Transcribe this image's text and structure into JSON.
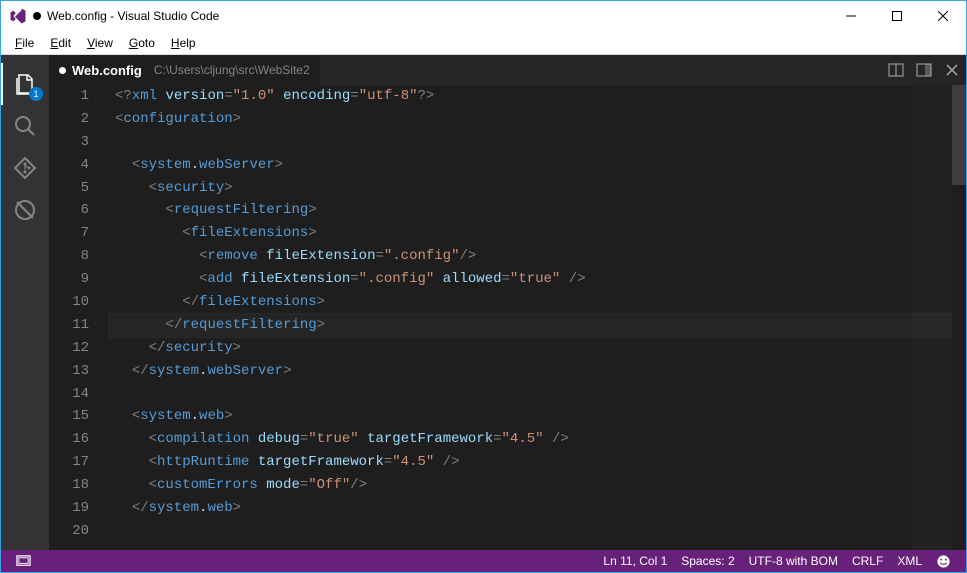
{
  "window": {
    "title": "Web.config - Visual Studio Code",
    "dirty": true
  },
  "menubar": {
    "items": [
      {
        "label": "File",
        "u": 0
      },
      {
        "label": "Edit",
        "u": 0
      },
      {
        "label": "View",
        "u": 0
      },
      {
        "label": "Goto",
        "u": 0
      },
      {
        "label": "Help",
        "u": 0
      }
    ]
  },
  "activitybar": {
    "explorer_badge": "1"
  },
  "tabs": {
    "file": "Web.config",
    "path": "C:\\Users\\cljung\\src\\WebSite2"
  },
  "editor": {
    "lines": [
      [
        {
          "t": "br",
          "v": "<?"
        },
        {
          "t": "tag",
          "v": "xml"
        },
        {
          "t": "plain",
          "v": " "
        },
        {
          "t": "attr",
          "v": "version"
        },
        {
          "t": "br",
          "v": "="
        },
        {
          "t": "str",
          "v": "\"1.0\""
        },
        {
          "t": "plain",
          "v": " "
        },
        {
          "t": "attr",
          "v": "encoding"
        },
        {
          "t": "br",
          "v": "="
        },
        {
          "t": "str",
          "v": "\"utf-8\""
        },
        {
          "t": "br",
          "v": "?>"
        }
      ],
      [
        {
          "t": "br",
          "v": "<"
        },
        {
          "t": "tag",
          "v": "configuration"
        },
        {
          "t": "br",
          "v": ">"
        }
      ],
      [],
      [
        {
          "t": "indent",
          "v": "  "
        },
        {
          "t": "br",
          "v": "<"
        },
        {
          "t": "tag",
          "v": "system"
        },
        {
          "t": "dot",
          "v": "."
        },
        {
          "t": "tag",
          "v": "webServer"
        },
        {
          "t": "br",
          "v": ">"
        }
      ],
      [
        {
          "t": "indent",
          "v": "    "
        },
        {
          "t": "br",
          "v": "<"
        },
        {
          "t": "tag",
          "v": "security"
        },
        {
          "t": "br",
          "v": ">"
        }
      ],
      [
        {
          "t": "indent",
          "v": "      "
        },
        {
          "t": "br",
          "v": "<"
        },
        {
          "t": "tag",
          "v": "requestFiltering"
        },
        {
          "t": "br",
          "v": ">"
        }
      ],
      [
        {
          "t": "indent",
          "v": "        "
        },
        {
          "t": "br",
          "v": "<"
        },
        {
          "t": "tag",
          "v": "fileExtensions"
        },
        {
          "t": "br",
          "v": ">"
        }
      ],
      [
        {
          "t": "indent",
          "v": "          "
        },
        {
          "t": "br",
          "v": "<"
        },
        {
          "t": "tag",
          "v": "remove"
        },
        {
          "t": "plain",
          "v": " "
        },
        {
          "t": "attr",
          "v": "fileExtension"
        },
        {
          "t": "br",
          "v": "="
        },
        {
          "t": "str",
          "v": "\".config\""
        },
        {
          "t": "br",
          "v": "/>"
        }
      ],
      [
        {
          "t": "indent",
          "v": "          "
        },
        {
          "t": "br",
          "v": "<"
        },
        {
          "t": "tag",
          "v": "add"
        },
        {
          "t": "plain",
          "v": " "
        },
        {
          "t": "attr",
          "v": "fileExtension"
        },
        {
          "t": "br",
          "v": "="
        },
        {
          "t": "str",
          "v": "\".config\""
        },
        {
          "t": "plain",
          "v": " "
        },
        {
          "t": "attr",
          "v": "allowed"
        },
        {
          "t": "br",
          "v": "="
        },
        {
          "t": "str",
          "v": "\"true\""
        },
        {
          "t": "plain",
          "v": " "
        },
        {
          "t": "br",
          "v": "/>"
        }
      ],
      [
        {
          "t": "indent",
          "v": "        "
        },
        {
          "t": "br",
          "v": "</"
        },
        {
          "t": "tag",
          "v": "fileExtensions"
        },
        {
          "t": "br",
          "v": ">"
        }
      ],
      [
        {
          "t": "indent",
          "v": "      "
        },
        {
          "t": "br",
          "v": "</"
        },
        {
          "t": "tag",
          "v": "requestFiltering"
        },
        {
          "t": "br",
          "v": ">"
        }
      ],
      [
        {
          "t": "indent",
          "v": "    "
        },
        {
          "t": "br",
          "v": "</"
        },
        {
          "t": "tag",
          "v": "security"
        },
        {
          "t": "br",
          "v": ">"
        }
      ],
      [
        {
          "t": "indent",
          "v": "  "
        },
        {
          "t": "br",
          "v": "</"
        },
        {
          "t": "tag",
          "v": "system"
        },
        {
          "t": "dot",
          "v": "."
        },
        {
          "t": "tag",
          "v": "webServer"
        },
        {
          "t": "br",
          "v": ">"
        }
      ],
      [],
      [
        {
          "t": "indent",
          "v": "  "
        },
        {
          "t": "br",
          "v": "<"
        },
        {
          "t": "tag",
          "v": "system"
        },
        {
          "t": "dot",
          "v": "."
        },
        {
          "t": "tag",
          "v": "web"
        },
        {
          "t": "br",
          "v": ">"
        }
      ],
      [
        {
          "t": "indent",
          "v": "    "
        },
        {
          "t": "br",
          "v": "<"
        },
        {
          "t": "tag",
          "v": "compilation"
        },
        {
          "t": "plain",
          "v": " "
        },
        {
          "t": "attr",
          "v": "debug"
        },
        {
          "t": "br",
          "v": "="
        },
        {
          "t": "str",
          "v": "\"true\""
        },
        {
          "t": "plain",
          "v": " "
        },
        {
          "t": "attr",
          "v": "targetFramework"
        },
        {
          "t": "br",
          "v": "="
        },
        {
          "t": "str",
          "v": "\"4.5\""
        },
        {
          "t": "plain",
          "v": " "
        },
        {
          "t": "br",
          "v": "/>"
        }
      ],
      [
        {
          "t": "indent",
          "v": "    "
        },
        {
          "t": "br",
          "v": "<"
        },
        {
          "t": "tag",
          "v": "httpRuntime"
        },
        {
          "t": "plain",
          "v": " "
        },
        {
          "t": "attr",
          "v": "targetFramework"
        },
        {
          "t": "br",
          "v": "="
        },
        {
          "t": "str",
          "v": "\"4.5\""
        },
        {
          "t": "plain",
          "v": " "
        },
        {
          "t": "br",
          "v": "/>"
        }
      ],
      [
        {
          "t": "indent",
          "v": "    "
        },
        {
          "t": "br",
          "v": "<"
        },
        {
          "t": "tag",
          "v": "customErrors"
        },
        {
          "t": "plain",
          "v": " "
        },
        {
          "t": "attr",
          "v": "mode"
        },
        {
          "t": "br",
          "v": "="
        },
        {
          "t": "str",
          "v": "\"Off\""
        },
        {
          "t": "br",
          "v": "/>"
        }
      ],
      [
        {
          "t": "indent",
          "v": "  "
        },
        {
          "t": "br",
          "v": "</"
        },
        {
          "t": "tag",
          "v": "system"
        },
        {
          "t": "dot",
          "v": "."
        },
        {
          "t": "tag",
          "v": "web"
        },
        {
          "t": "br",
          "v": ">"
        }
      ],
      []
    ],
    "current_line": 11
  },
  "statusbar": {
    "cursor": "Ln 11, Col 1",
    "spaces": "Spaces: 2",
    "encoding": "UTF-8 with BOM",
    "eol": "CRLF",
    "lang": "XML"
  }
}
